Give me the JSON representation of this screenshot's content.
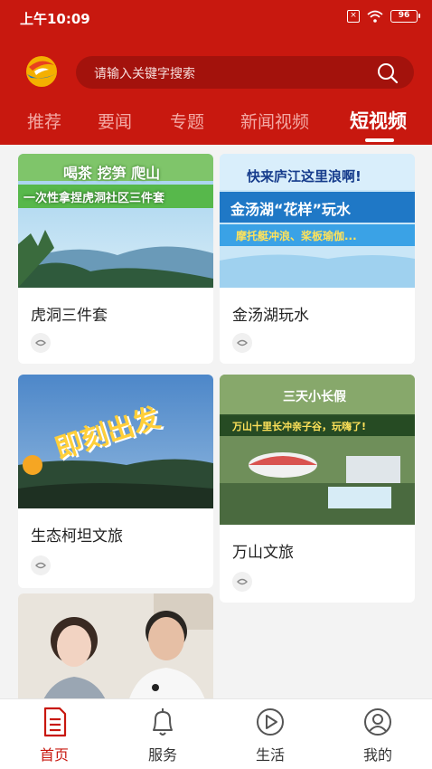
{
  "status": {
    "time": "上午10:09",
    "battery": "96"
  },
  "search": {
    "placeholder": "请输入关键字搜索"
  },
  "tabs": [
    "推荐",
    "要闻",
    "专题",
    "新闻视频",
    "短视频"
  ],
  "active_tab": "短视频",
  "cards": [
    {
      "title": "虎洞三件套",
      "overlay": [
        "喝茶 挖笋 爬山",
        "一次性拿捏虎洞社区三件套"
      ]
    },
    {
      "title": "金汤湖玩水",
      "overlay": [
        "快来庐江这里浪啊!",
        "金汤湖“花样”玩水",
        "摩托艇冲浪、桨板瑜伽..."
      ]
    },
    {
      "title": "生态柯坦文旅",
      "overlay": [
        "即刻出发"
      ]
    },
    {
      "title": "万山文旅",
      "overlay": [
        "三天小长假",
        "万山十里长冲亲子谷，玩嗨了!"
      ]
    },
    {
      "title": "",
      "overlay": []
    }
  ],
  "bottom_nav": [
    {
      "label": "首页",
      "icon": "document-icon",
      "active": true
    },
    {
      "label": "服务",
      "icon": "bell-icon",
      "active": false
    },
    {
      "label": "生活",
      "icon": "play-icon",
      "active": false
    },
    {
      "label": "我的",
      "icon": "user-icon",
      "active": false
    }
  ],
  "colors": {
    "brand_red": "#c8180f",
    "search_bg": "#a3120c",
    "inactive_tab": "#f3a9a4"
  }
}
